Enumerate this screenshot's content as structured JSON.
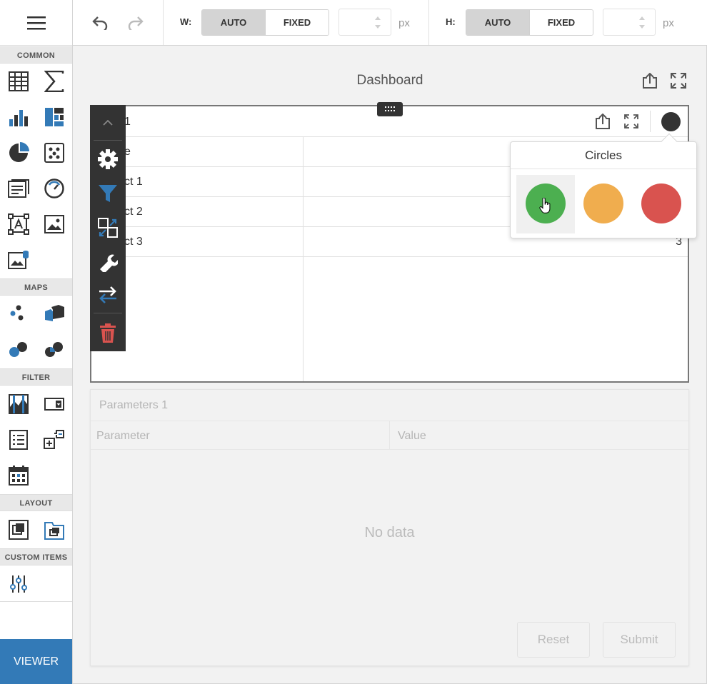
{
  "toolbox": {
    "groups": {
      "common": "COMMON",
      "maps": "MAPS",
      "filter": "FILTER",
      "layout": "LAYOUT",
      "custom": "CUSTOM ITEMS"
    },
    "viewer_label": "VIEWER"
  },
  "toolbar": {
    "width_label": "W:",
    "height_label": "H:",
    "auto_label": "AUTO",
    "fixed_label": "FIXED",
    "unit": "px",
    "width_value": "",
    "height_value": ""
  },
  "dashboard": {
    "title": "Dashboard",
    "grid": {
      "caption": "1",
      "header_left": "e",
      "rows": [
        {
          "c1": "ct 1",
          "c2": ""
        },
        {
          "c1": "ct 2",
          "c2": ""
        },
        {
          "c1": "ct 3",
          "c2": "3"
        }
      ]
    },
    "color_popup": {
      "title": "Circles",
      "colors": [
        "#4caf50",
        "#f0ad4e",
        "#d9534f"
      ],
      "selected": 0
    },
    "params": {
      "title": "Parameters 1",
      "col_parameter": "Parameter",
      "col_value": "Value",
      "no_data": "No data",
      "reset_label": "Reset",
      "submit_label": "Submit"
    }
  },
  "colors": {
    "accent": "#337ab7",
    "delete": "#d9534f",
    "menu_bg": "#333333"
  }
}
